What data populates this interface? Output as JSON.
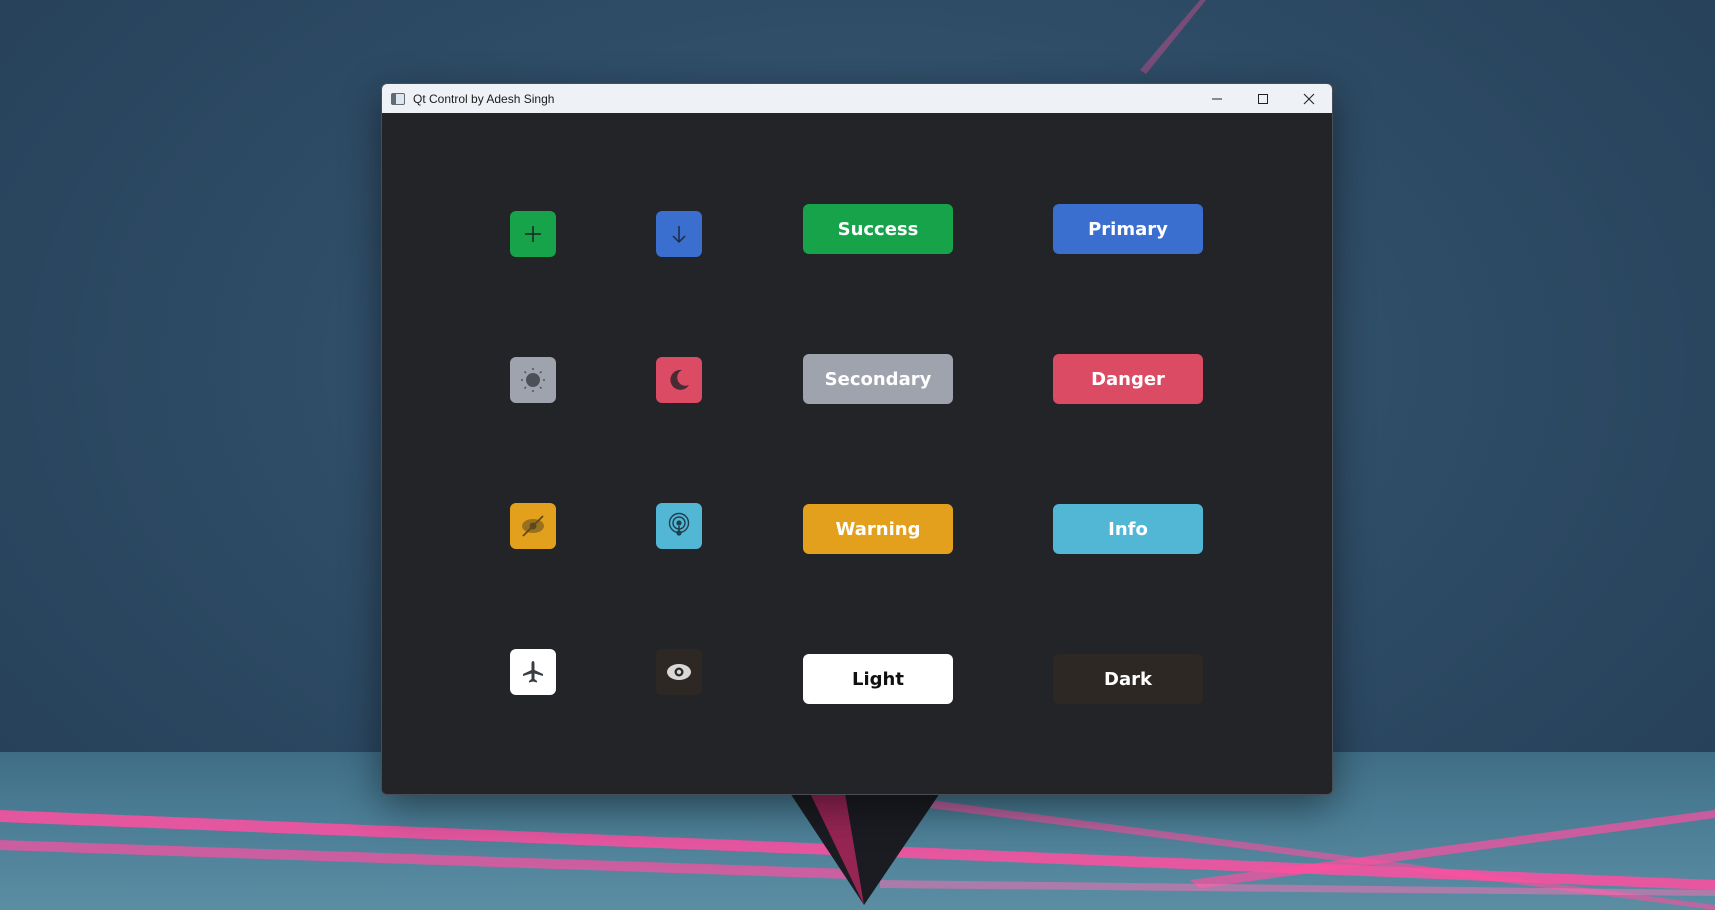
{
  "window": {
    "title": "Qt Control by Adesh Singh",
    "controls": [
      "minimize-icon",
      "maximize-icon",
      "close-icon"
    ]
  },
  "icon_buttons": [
    {
      "icon": "plus-icon",
      "color": "#16a34a",
      "glyph_color": "#1f2a22"
    },
    {
      "icon": "arrow-down-icon",
      "color": "#3a6fd0",
      "glyph_color": "#1d2a44"
    },
    {
      "icon": "sun-icon",
      "color": "#9ea3ad",
      "glyph_color": "#4c5057"
    },
    {
      "icon": "moon-icon",
      "color": "#dc4b64",
      "glyph_color": "#4a2a33"
    },
    {
      "icon": "eye-slash-icon",
      "color": "#e3a01d",
      "glyph_color": "#5c4a1f"
    },
    {
      "icon": "broadcast-icon",
      "color": "#52b6d5",
      "glyph_color": "#1f3f4c"
    },
    {
      "icon": "airplane-icon",
      "color": "#ffffff",
      "glyph_color": "#3b3d44"
    },
    {
      "icon": "eye-icon",
      "color": "#2e2825",
      "glyph_color": "#d8d8d8"
    }
  ],
  "text_buttons": {
    "success": {
      "label": "Success",
      "color": "#16a34a",
      "text_color": "#ffffff"
    },
    "primary": {
      "label": "Primary",
      "color": "#3a6fd0",
      "text_color": "#ffffff"
    },
    "secondary": {
      "label": "Secondary",
      "color": "#9ea3ad",
      "text_color": "#ffffff"
    },
    "danger": {
      "label": "Danger",
      "color": "#dc4b64",
      "text_color": "#ffffff"
    },
    "warning": {
      "label": "Warning",
      "color": "#e3a01d",
      "text_color": "#ffffff"
    },
    "info": {
      "label": "Info",
      "color": "#52b6d5",
      "text_color": "#ffffff"
    },
    "light": {
      "label": "Light",
      "color": "#ffffff",
      "text_color": "#111111"
    },
    "dark": {
      "label": "Dark",
      "color": "#2e2825",
      "text_color": "#ffffff"
    }
  },
  "colors": {
    "window_bg": "#232428",
    "titlebar_bg": "#eef2f7",
    "desktop_accent": "#ff3d8b"
  }
}
